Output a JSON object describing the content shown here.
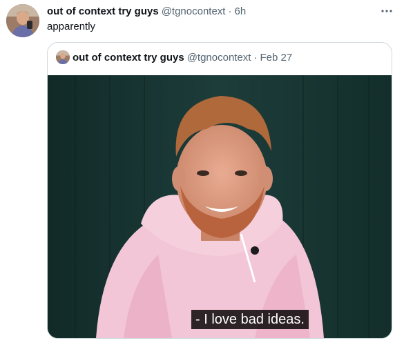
{
  "tweet": {
    "author_name": "out of context try guys",
    "author_handle": "@tgnocontext",
    "separator": "·",
    "time": "6h",
    "text": "apparently",
    "more_icon": "more-horizontal-icon"
  },
  "quoted_tweet": {
    "author_name": "out of context try guys",
    "author_handle": "@tgnocontext",
    "separator": "·",
    "date": "Feb 27",
    "media": {
      "subtitle": "- I love bad ideas."
    }
  },
  "colors": {
    "text_primary": "#0f1419",
    "text_secondary": "#536471",
    "border": "#cfd9de",
    "media_background": "#173532",
    "hoodie": "#f2c6d6"
  }
}
